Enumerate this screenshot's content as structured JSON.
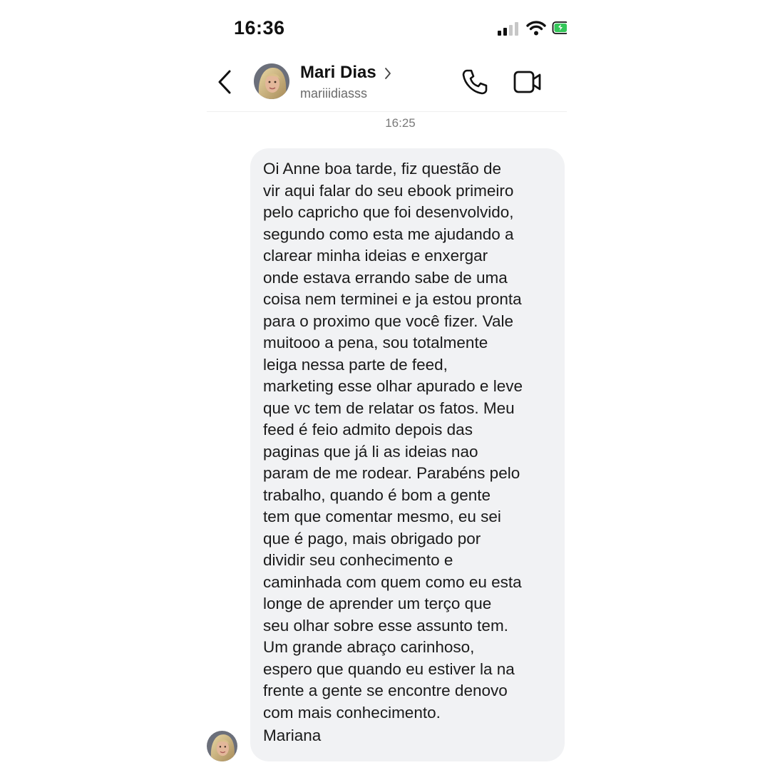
{
  "status_bar": {
    "time": "16:36",
    "icons": [
      "signal-icon",
      "wifi-icon",
      "battery-icon"
    ]
  },
  "header": {
    "contact_name": "Mari Dias",
    "username": "mariiidiasss",
    "icons": [
      "back-icon",
      "avatar",
      "chevron-right-icon",
      "phone-call-icon",
      "video-call-icon"
    ]
  },
  "conversation": {
    "timestamp": "16:25",
    "message_lines": [
      "Oi Anne boa tarde, fiz questão de",
      "vir aqui falar do seu ebook primeiro",
      "pelo capricho que foi desenvolvido,",
      "segundo como esta me ajudando a",
      "clarear minha ideias e enxergar",
      "onde estava errando sabe de uma",
      "coisa nem terminei e ja estou pronta",
      "para o proximo que você fizer. Vale",
      "muitooo a pena, sou totalmente",
      "leiga nessa parte de feed,",
      "marketing esse olhar apurado e leve",
      "que vc tem de relatar os fatos. Meu",
      "feed é feio admito depois das",
      "paginas que já li as ideias nao",
      "param de me rodear. Parabéns pelo",
      "trabalho, quando é bom a gente",
      "tem que comentar mesmo, eu sei",
      "que é pago, mais obrigado por",
      "dividir seu conhecimento e",
      "caminhada com quem como eu esta",
      "longe de aprender um terço que",
      "seu olhar sobre esse assunto tem.",
      "Um grande abraço carinhoso,",
      "espero que quando eu estiver la na",
      "frente a gente se encontre denovo",
      "com mais conhecimento."
    ],
    "signoff": "Mariana"
  }
}
